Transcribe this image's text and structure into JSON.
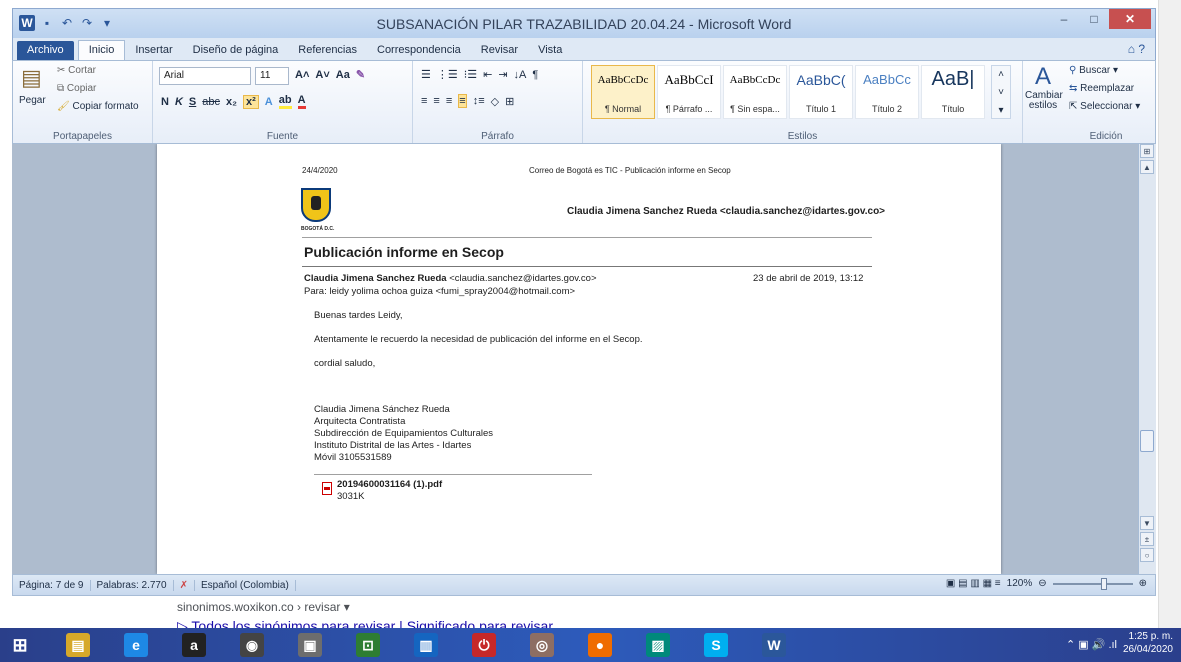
{
  "window": {
    "title": "SUBSANACIÓN PILAR TRAZABILIDAD 20.04.24  -  Microsoft Word",
    "minimize": "–",
    "maximize": "□",
    "close": "✕"
  },
  "tabs": [
    "Archivo",
    "Inicio",
    "Insertar",
    "Diseño de página",
    "Referencias",
    "Correspondencia",
    "Revisar",
    "Vista"
  ],
  "ribbon": {
    "clipboard": {
      "paste": "Pegar",
      "cut": "Cortar",
      "copy": "Copiar",
      "format_painter": "Copiar formato",
      "label": "Portapapeles"
    },
    "font": {
      "name": "Arial",
      "size": "11",
      "label": "Fuente"
    },
    "paragraph": {
      "label": "Párrafo"
    },
    "styles": {
      "label": "Estilos",
      "change_styles": "Cambiar estilos",
      "items": [
        {
          "sample": "AaBbCcDc",
          "name": "¶ Normal"
        },
        {
          "sample": "AaBbCcI",
          "name": "¶ Párrafo ..."
        },
        {
          "sample": "AaBbCcDc",
          "name": "¶ Sin espa..."
        },
        {
          "sample": "AaBbC(",
          "name": "Título 1"
        },
        {
          "sample": "AaBbCc",
          "name": "Título 2"
        },
        {
          "sample": "AaB|",
          "name": "Título"
        }
      ]
    },
    "editing": {
      "find": "Buscar",
      "replace": "Reemplazar",
      "select": "Seleccionar",
      "label": "Edición"
    }
  },
  "document": {
    "header_date": "24/4/2020",
    "header_title": "Correo de Bogotá es TIC - Publicación informe en Secop",
    "crest_caption": "BOGOTÁ D.C.",
    "account": "Claudia Jimena Sanchez Rueda <claudia.sanchez@idartes.gov.co>",
    "subject": "Publicación informe en Secop",
    "from_name": "Claudia Jimena Sanchez Rueda",
    "from_email": "<claudia.sanchez@idartes.gov.co>",
    "date": "23 de abril de 2019, 13:12",
    "to": "Para: leidy yolima ochoa guiza <fumi_spray2004@hotmail.com>",
    "body": [
      "Buenas tardes Leidy,",
      "Atentamente le recuerdo la necesidad de publicación del informe en el Secop.",
      "cordial saludo,"
    ],
    "signature": [
      "Claudia Jimena Sánchez Rueda",
      "Arquitecta Contratista",
      "Subdirección de Equipamientos Culturales",
      "Instituto Distrital de las Artes - Idartes",
      "Móvil 3105531589"
    ],
    "attachment_name": "20194600031164 (1).pdf",
    "attachment_size": "3031K"
  },
  "status": {
    "page": "Página: 7 de 9",
    "words": "Palabras: 2.770",
    "language": "Español (Colombia)",
    "zoom": "120%"
  },
  "browser_below": {
    "breadcrumb": "sinonimos.woxikon.co › revisar ▾",
    "link": "▷ Todos los sinónimos para revisar | Significado para revisar"
  },
  "taskbar": {
    "time": "1:25 p. m.",
    "date": "26/04/2020",
    "apps": [
      {
        "glyph": "⊞",
        "color": "#2b579a"
      },
      {
        "glyph": "▤",
        "color": "#d6a82a"
      },
      {
        "glyph": "e",
        "color": "#1e88e5"
      },
      {
        "glyph": "a",
        "color": "#222222"
      },
      {
        "glyph": "◉",
        "color": "#444444"
      },
      {
        "glyph": "▣",
        "color": "#6d6d6d"
      },
      {
        "glyph": "⊡",
        "color": "#2e7d32"
      },
      {
        "glyph": "▥",
        "color": "#1565c0"
      },
      {
        "glyph": "⏻",
        "color": "#c62828"
      },
      {
        "glyph": "◎",
        "color": "#8d6e63"
      },
      {
        "glyph": "●",
        "color": "#ef6c00"
      },
      {
        "glyph": "▨",
        "color": "#00897b"
      },
      {
        "glyph": "S",
        "color": "#00aff0"
      },
      {
        "glyph": "W",
        "color": "#2b579a"
      }
    ]
  }
}
